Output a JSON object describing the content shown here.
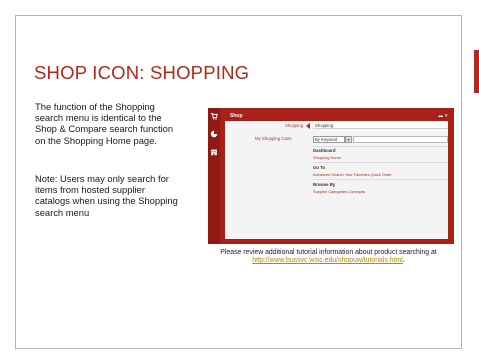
{
  "slide": {
    "title": "SHOP ICON: SHOPPING",
    "paragraph_1": "The function of the Shopping search menu is identical to the Shop & Compare search function on the Shopping Home page.",
    "paragraph_2": "Note: Users may only search for items from hosted supplier catalogs when using the Shopping search menu",
    "caption_line": "Please review additional tutorial information about product searching at",
    "caption_link": "http://www.bussvc.wisc.edu/shopuw/tutorials.html",
    "caption_end": ".",
    "accent_color": "#b5261d"
  },
  "screenshot": {
    "header_title": "Shop",
    "header_controls": "▬ ✕",
    "rows": {
      "shopping_label": "Shopping",
      "shopping_value": "Shopping",
      "carts_label": "My Shopping Carts",
      "search_select": "By Keyword",
      "dashboard_heading": "Dashboard",
      "dashboard_link": "Shopping Home",
      "goto_heading": "Go To",
      "goto_links": "Advanced Search   Your Favorites   Quick Order",
      "browse_heading": "Browse By",
      "browse_links": "Supplier   Categories   Contracts"
    },
    "rail_icons": [
      "cart-icon",
      "pie-chart-icon",
      "building-icon"
    ]
  }
}
